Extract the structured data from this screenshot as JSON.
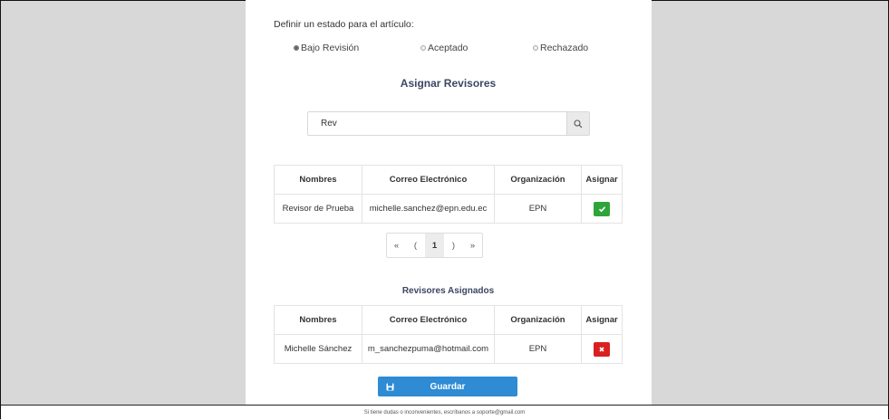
{
  "form": {
    "state_label": "Definir un estado para el artículo:",
    "radios": [
      {
        "label": "Bajo Revisión",
        "checked": true
      },
      {
        "label": "Aceptado",
        "checked": false
      },
      {
        "label": "Rechazado",
        "checked": false
      }
    ],
    "assign_title": "Asignar Revisores",
    "search": {
      "value": "Rev",
      "icon": "search-icon"
    }
  },
  "results_table": {
    "headers": [
      "Nombres",
      "Correo Electrónico",
      "Organización",
      "Asignar"
    ],
    "rows": [
      {
        "name": "Revisor de Prueba",
        "email": "michelle.sanchez@epn.edu.ec",
        "org": "EPN",
        "action_icon": "check-icon"
      }
    ]
  },
  "pagination": {
    "first": "«",
    "prev": "(",
    "page": "1",
    "next": ")",
    "last": "»"
  },
  "assigned": {
    "title": "Revisores Asignados",
    "headers": [
      "Nombres",
      "Correo Electrónico",
      "Organización",
      "Asignar"
    ],
    "rows": [
      {
        "name": "Michelle Sánchez",
        "email": "m_sanchezpuma@hotmail.com",
        "org": "EPN",
        "action_icon": "remove-icon"
      }
    ]
  },
  "save_button": {
    "label": "Guardar",
    "icon": "save-icon"
  },
  "footer": {
    "text": "Si tiene dudas o inconvenientes, escríbanos a soporte@gmail.com"
  },
  "colors": {
    "accent": "#2e8bd4",
    "success": "#2ea53a",
    "danger": "#d92020",
    "title": "#3d4663"
  }
}
